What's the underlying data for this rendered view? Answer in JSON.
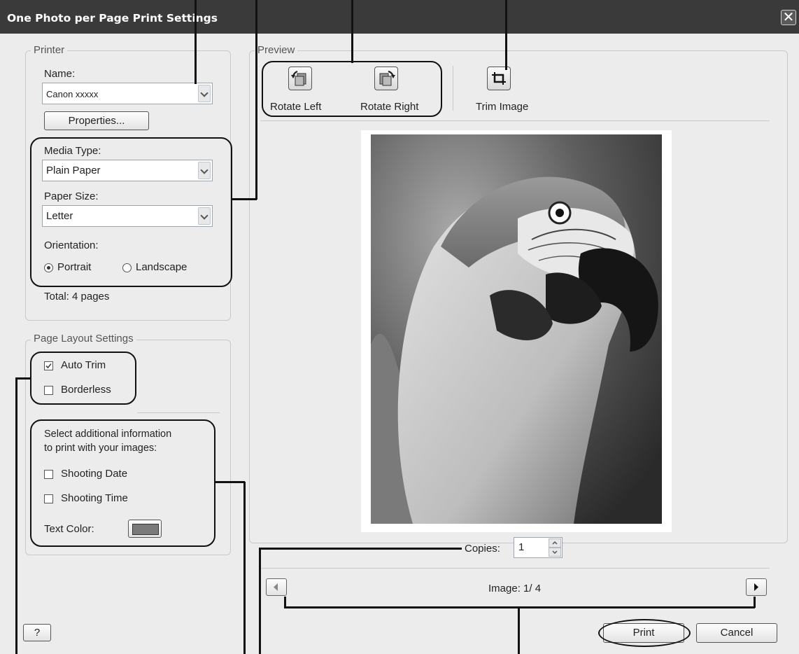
{
  "window": {
    "title": "One Photo per Page Print Settings",
    "close_glyph": "✕"
  },
  "printer": {
    "group_title": "Printer",
    "name_label": "Name:",
    "name_value": "Canon xxxxx",
    "properties_label": "Properties...",
    "media_type_label": "Media Type:",
    "media_type_value": "Plain Paper",
    "paper_size_label": "Paper Size:",
    "paper_size_value": "Letter",
    "orientation_label": "Orientation:",
    "portrait_label": "Portrait",
    "landscape_label": "Landscape",
    "orientation_selected": "Portrait",
    "total_text": "Total: 4 pages"
  },
  "layout": {
    "group_title": "Page Layout Settings",
    "auto_trim_label": "Auto Trim",
    "auto_trim_checked": true,
    "borderless_label": "Borderless",
    "borderless_checked": false,
    "info_text_line1": "Select additional information",
    "info_text_line2": "to print with your images:",
    "shooting_date_label": "Shooting Date",
    "shooting_time_label": "Shooting Time",
    "text_color_label": "Text Color:",
    "text_color_value": "#7a7a7a"
  },
  "preview": {
    "group_title": "Preview",
    "rotate_left_label": "Rotate Left",
    "rotate_right_label": "Rotate Right",
    "trim_image_label": "Trim Image",
    "copies_label": "Copies:",
    "copies_value": "1",
    "image_counter": "Image: 1/ 4",
    "photo_subject": "parrot-photo"
  },
  "footer": {
    "help_label": "?",
    "print_label": "Print",
    "cancel_label": "Cancel"
  }
}
